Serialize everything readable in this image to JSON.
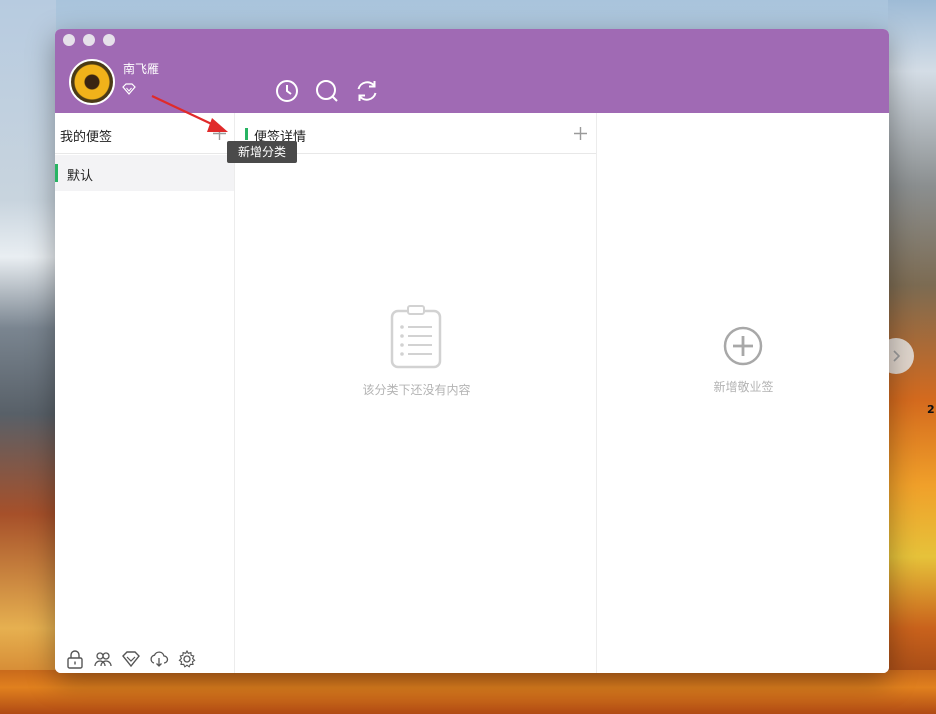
{
  "window": {
    "user": {
      "name": "南飞雁"
    },
    "toolbar": {
      "history_icon": "clock-icon",
      "search_icon": "search-icon",
      "sync_icon": "sync-icon"
    },
    "accent_color": "#a06ab4",
    "selection_color": "#28b463"
  },
  "categories_panel": {
    "title": "我的便签",
    "add_icon": "plus-icon",
    "tooltip": "新增分类",
    "items": [
      {
        "label": "默认",
        "selected": true
      }
    ],
    "bottom_tools": [
      "lock-icon",
      "users-icon",
      "diamond-icon",
      "cloud-download-icon",
      "gear-icon"
    ]
  },
  "notes_panel": {
    "title": "便签详情",
    "add_icon": "plus-icon",
    "empty_text": "该分类下还没有内容"
  },
  "detail_panel": {
    "add_icon": "plus-circle-icon",
    "add_label": "新增敬业签"
  },
  "desktop": {
    "edge_text": "2"
  }
}
